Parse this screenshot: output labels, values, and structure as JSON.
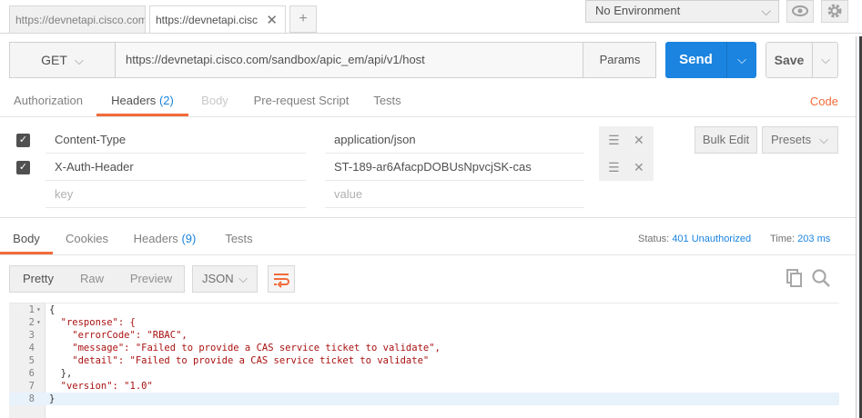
{
  "tabs": {
    "items": [
      {
        "label": "https://devnetapi.cisco.com"
      },
      {
        "label": "https://devnetapi.cisco.com"
      }
    ],
    "close_glyph": "✕",
    "add_glyph": "+"
  },
  "environment": {
    "selected": "No Environment"
  },
  "request": {
    "method": "GET",
    "url": "https://devnetapi.cisco.com/sandbox/apic_em/api/v1/host",
    "params_label": "Params",
    "send_label": "Send",
    "save_label": "Save"
  },
  "request_tabs": [
    {
      "label": "Authorization"
    },
    {
      "label": "Headers",
      "count": "(2)"
    },
    {
      "label": "Body"
    },
    {
      "label": "Pre-request Script"
    },
    {
      "label": "Tests"
    }
  ],
  "code_link": "Code",
  "headers": [
    {
      "key": "Content-Type",
      "value": "application/json",
      "checked": true
    },
    {
      "key": "X-Auth-Header",
      "value": "ST-189-ar6AfacpDOBUsNpvcjSK-cas",
      "checked": true
    }
  ],
  "new_header": {
    "key_placeholder": "key",
    "value_placeholder": "value"
  },
  "header_tools": {
    "bulk_edit": "Bulk Edit",
    "presets": "Presets"
  },
  "response_tabs": [
    {
      "label": "Body"
    },
    {
      "label": "Cookies"
    },
    {
      "label": "Headers",
      "count": "(9)"
    },
    {
      "label": "Tests"
    }
  ],
  "status": {
    "label": "Status:",
    "value": "401 Unauthorized"
  },
  "time": {
    "label": "Time:",
    "value": "203 ms"
  },
  "view_modes": [
    "Pretty",
    "Raw",
    "Preview"
  ],
  "language": "JSON",
  "code_lines": [
    {
      "num": "1",
      "fold": "▾",
      "text": "{"
    },
    {
      "num": "2",
      "fold": "▾",
      "text": "  \"response\": {"
    },
    {
      "num": "3",
      "fold": "",
      "text": "    \"errorCode\": \"RBAC\","
    },
    {
      "num": "4",
      "fold": "",
      "text": "    \"message\": \"Failed to provide a CAS service ticket to validate\","
    },
    {
      "num": "5",
      "fold": "",
      "text": "    \"detail\": \"Failed to provide a CAS service ticket to validate\""
    },
    {
      "num": "6",
      "fold": "",
      "text": "  },"
    },
    {
      "num": "7",
      "fold": "",
      "text": "  \"version\": \"1.0\""
    },
    {
      "num": "8",
      "fold": "",
      "text": "}"
    }
  ],
  "icons": [
    "close-icon",
    "plus-icon",
    "chevron-down-icon",
    "eye-icon",
    "gear-icon",
    "checkbox-checked-icon",
    "drag-handle-icon",
    "delete-icon",
    "wrap-lines-icon",
    "copy-icon",
    "search-icon"
  ],
  "colors": {
    "accent": "#f26b3a",
    "send": "#1a84e0",
    "link": "#1a84e0"
  }
}
